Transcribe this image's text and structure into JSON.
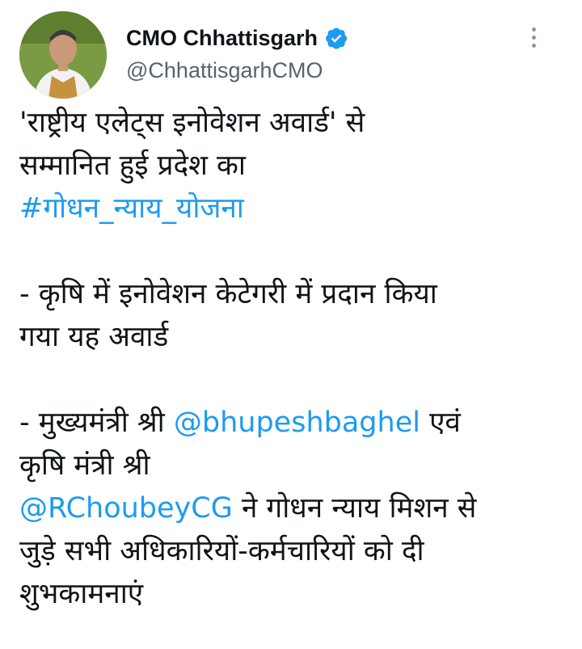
{
  "account": {
    "display_name": "CMO Chhattisgarh",
    "handle": "@ChhattisgarhCMO",
    "verified_icon": "verified-badge-icon",
    "more_icon": "more-options-icon"
  },
  "tweet": {
    "line1": "'राष्ट्रीय एलेट्स इनोवेशन अवार्ड' से",
    "line2": "सम्मानित हुई प्रदेश का",
    "hashtag": "#गोधन_न्याय_योजना",
    "line4": "- कृषि में इनोवेशन केटेगरी में प्रदान किया",
    "line5": "गया यह अवार्ड",
    "line6_prefix": "- मुख्यमंत्री श्री ",
    "mention1": "@bhupeshbaghel",
    "line6_suffix": " एवं",
    "line7": "कृषि मंत्री श्री",
    "mention2": "@RChoubeyCG",
    "line8_suffix": " ने गोधन न्याय मिशन से",
    "line9": "जुड़े सभी अधिकारियों-कर्मचारियों को दी",
    "line10": "शुभकामनाएं"
  },
  "colors": {
    "link": "#1d9bf0",
    "text": "#0f1419",
    "secondary": "#536471"
  }
}
